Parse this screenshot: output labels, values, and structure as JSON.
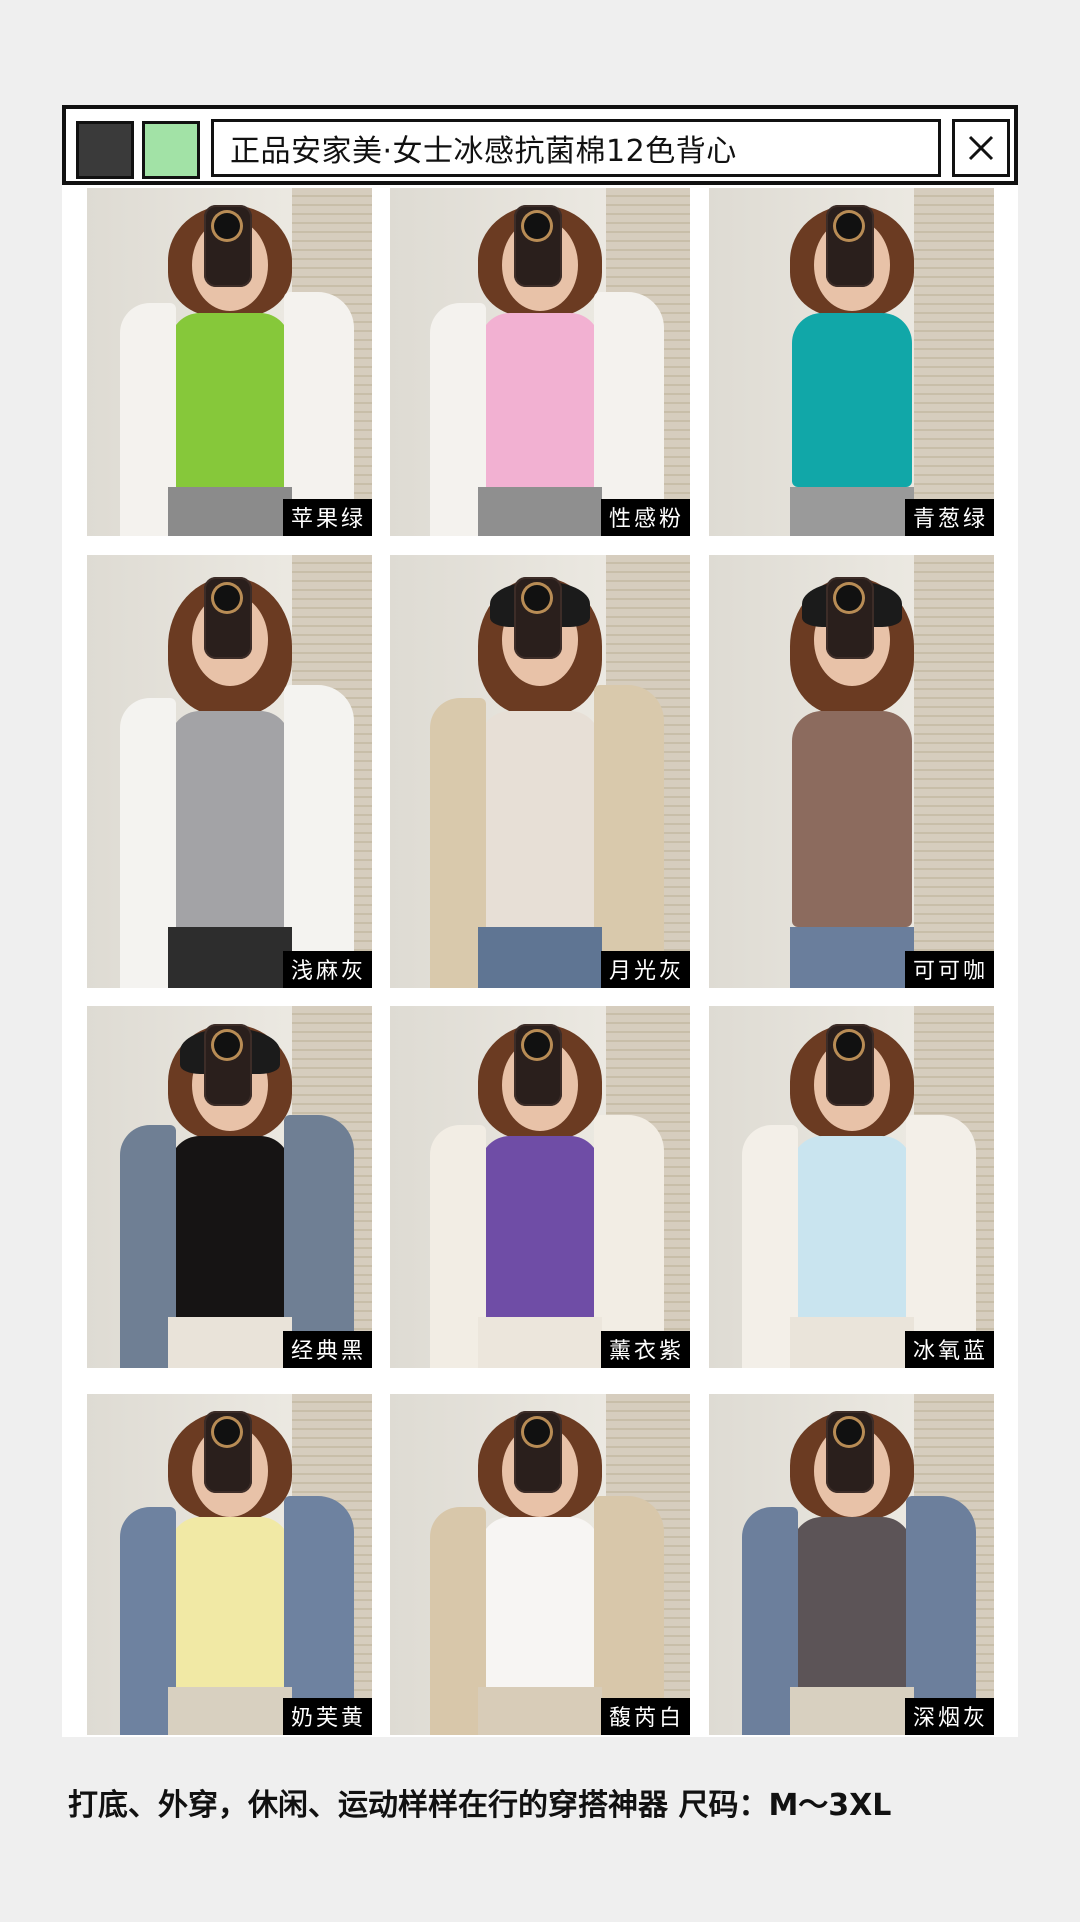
{
  "header": {
    "title": "正品安家美·女士冰感抗菌棉12色背心",
    "swatches": [
      {
        "name": "dark-swatch",
        "color": "#3a3a3a"
      },
      {
        "name": "green-swatch",
        "color": "#a2e2a6"
      }
    ],
    "close_icon": "close-icon"
  },
  "products": [
    {
      "color_name": "苹果绿",
      "top": "#86c83a",
      "jacket": "#f4f2ee",
      "pants": "#8b8b8b",
      "hat": "none"
    },
    {
      "color_name": "性感粉",
      "top": "#f2b1d2",
      "jacket": "#f4f2ee",
      "pants": "#8f8f8f",
      "hat": "none"
    },
    {
      "color_name": "青葱绿",
      "top": "#11a7a8",
      "jacket": "none",
      "pants": "#9a9a9a",
      "hat": "none"
    },
    {
      "color_name": "浅麻灰",
      "top": "#a3a3a6",
      "jacket": "#f4f3f0",
      "pants": "#2d2d2d",
      "hat": "none"
    },
    {
      "color_name": "月光灰",
      "top": "#e7dfd6",
      "jacket": "#d9c9ac",
      "pants": "#5f7593",
      "hat": "black"
    },
    {
      "color_name": "可可咖",
      "top": "#8c6b5e",
      "jacket": "none",
      "pants": "#6a7e9c",
      "hat": "black"
    },
    {
      "color_name": "经典黑",
      "top": "#161414",
      "jacket": "#6f7f94",
      "pants": "#e9e3d9",
      "hat": "black"
    },
    {
      "color_name": "薰衣紫",
      "top": "#6f4da6",
      "jacket": "#f2ede4",
      "pants": "#ece6dc",
      "hat": "none"
    },
    {
      "color_name": "冰氧蓝",
      "top": "#c9e4ef",
      "jacket": "#f3efe8",
      "pants": "#eae4da",
      "hat": "none"
    },
    {
      "color_name": "奶芙黄",
      "top": "#f1e9a5",
      "jacket": "#6e82a0",
      "pants": "#d8d0c0",
      "hat": "none"
    },
    {
      "color_name": "馥芮白",
      "top": "#f7f5f3",
      "jacket": "#d8c7aa",
      "pants": "#d8ccb8",
      "hat": "none"
    },
    {
      "color_name": "深烟灰",
      "top": "#5c5457",
      "jacket": "#6c7f9c",
      "pants": "#d8d0c0",
      "hat": "none"
    }
  ],
  "caption": "打底、外穿，休闲、运动样样在行的穿搭神器  尺码：M～3XL",
  "colors": {
    "background": "#efefef",
    "frame": "#ffffff",
    "wall": "#dedbd3",
    "hair": "#6b3b22",
    "label_bg": "#000000"
  }
}
